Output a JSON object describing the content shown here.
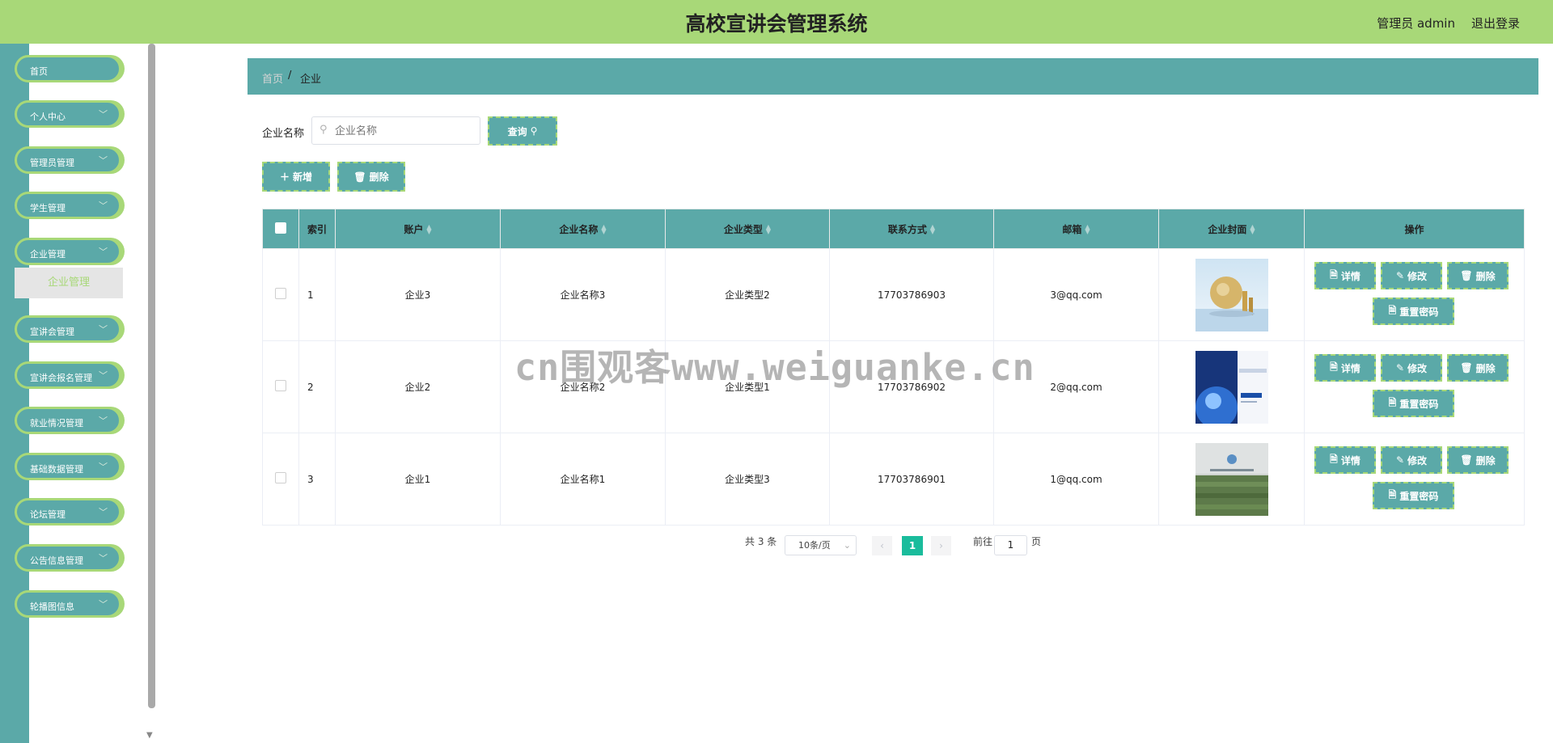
{
  "header": {
    "title": "高校宣讲会管理系统",
    "user_label": "管理员 admin",
    "logout_label": "退出登录",
    "bg_color": "#a8d878"
  },
  "sidebar": {
    "items": [
      {
        "label": "首页"
      },
      {
        "label": "个人中心"
      },
      {
        "label": "管理员管理"
      },
      {
        "label": "学生管理"
      },
      {
        "label": "企业管理"
      },
      {
        "label": "宣讲会管理"
      },
      {
        "label": "宣讲会报名管理"
      },
      {
        "label": "就业情况管理"
      },
      {
        "label": "基础数据管理"
      },
      {
        "label": "论坛管理"
      },
      {
        "label": "公告信息管理"
      },
      {
        "label": "轮播图信息"
      }
    ],
    "submenu_active": "企业管理",
    "color": "#5ba9a8"
  },
  "breadcrumb": {
    "home": "首页",
    "sep": "/",
    "current": "企业"
  },
  "search": {
    "label": "企业名称",
    "placeholder": "企业名称",
    "value": "",
    "query_button": "查询"
  },
  "actions": {
    "add": "新增",
    "delete": "删除"
  },
  "table": {
    "columns": [
      "索引",
      "账户",
      "企业名称",
      "企业类型",
      "联系方式",
      "邮箱",
      "企业封面",
      "操作"
    ],
    "rows": [
      {
        "index": "1",
        "account": "企业3",
        "name": "企业名称3",
        "type": "企业类型2",
        "phone": "17703786903",
        "email": "3@qq.com",
        "cover": "cover-globe"
      },
      {
        "index": "2",
        "account": "企业2",
        "name": "企业名称2",
        "type": "企业类型1",
        "phone": "17703786902",
        "email": "2@qq.com",
        "cover": "cover-brochure"
      },
      {
        "index": "3",
        "account": "企业1",
        "name": "企业名称1",
        "type": "企业类型3",
        "phone": "17703786901",
        "email": "1@qq.com",
        "cover": "cover-office"
      }
    ],
    "row_actions": {
      "detail": "详情",
      "edit": "修改",
      "delete": "删除",
      "reset": "重置密码"
    }
  },
  "pagination": {
    "total": "共 3 条",
    "page_size": "10条/页",
    "current_page": "1",
    "goto_label": "前往",
    "goto_value": "1",
    "page_suffix": "页"
  },
  "watermark": "cn围观客www.weiguanke.cn"
}
